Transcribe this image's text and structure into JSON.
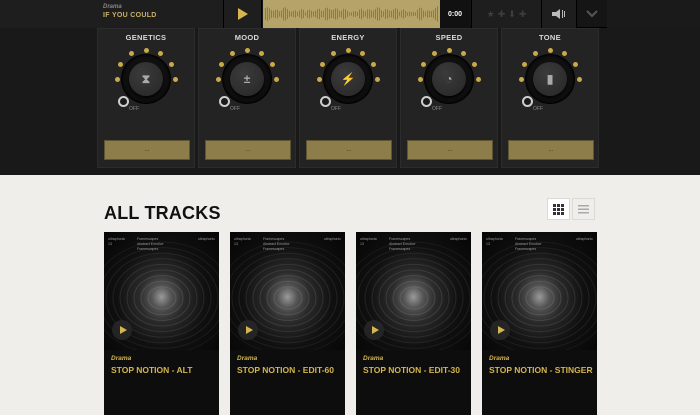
{
  "player": {
    "genre": "Drama",
    "title": "IF YOU COULD",
    "time": "0:00",
    "icons": [
      "play-icon",
      "star-icon",
      "add-icon",
      "download-icon",
      "share-icon",
      "volume-icon",
      "chevron-down-icon"
    ]
  },
  "filters": [
    {
      "label": "GENETICS",
      "field": "...",
      "icon": "dna-icon",
      "glyph": "⧗"
    },
    {
      "label": "MOOD",
      "field": "...",
      "icon": "plus-minus-icon",
      "glyph": "±"
    },
    {
      "label": "ENERGY",
      "field": "...",
      "icon": "lightning-icon",
      "glyph": "⚡"
    },
    {
      "label": "SPEED",
      "field": "...",
      "icon": "speedometer-icon",
      "glyph": "◔"
    },
    {
      "label": "TONE",
      "field": "...",
      "icon": "waveform-icon",
      "glyph": "▮"
    }
  ],
  "knob_off_label": "OFF",
  "tracks_section": {
    "title": "ALL TRACKS",
    "view_icons": [
      "grid-view-icon",
      "list-view-icon"
    ]
  },
  "tracks": [
    {
      "genre": "Drama",
      "name": "STOP NOTION - ALT"
    },
    {
      "genre": "Drama",
      "name": "STOP NOTION - EDIT-60"
    },
    {
      "genre": "Drama",
      "name": "STOP NOTION - EDIT-30"
    },
    {
      "genre": "Drama",
      "name": "STOP NOTION - STINGER"
    }
  ],
  "card_meta": {
    "brand": "ultraphonic",
    "num": "13",
    "line1": "Framescapes",
    "line2": "Abstract Emotive",
    "line3": "Framescapes"
  },
  "colors": {
    "accent": "#d4b54f",
    "waveform": "#b5a36a",
    "dark": "#191919"
  }
}
